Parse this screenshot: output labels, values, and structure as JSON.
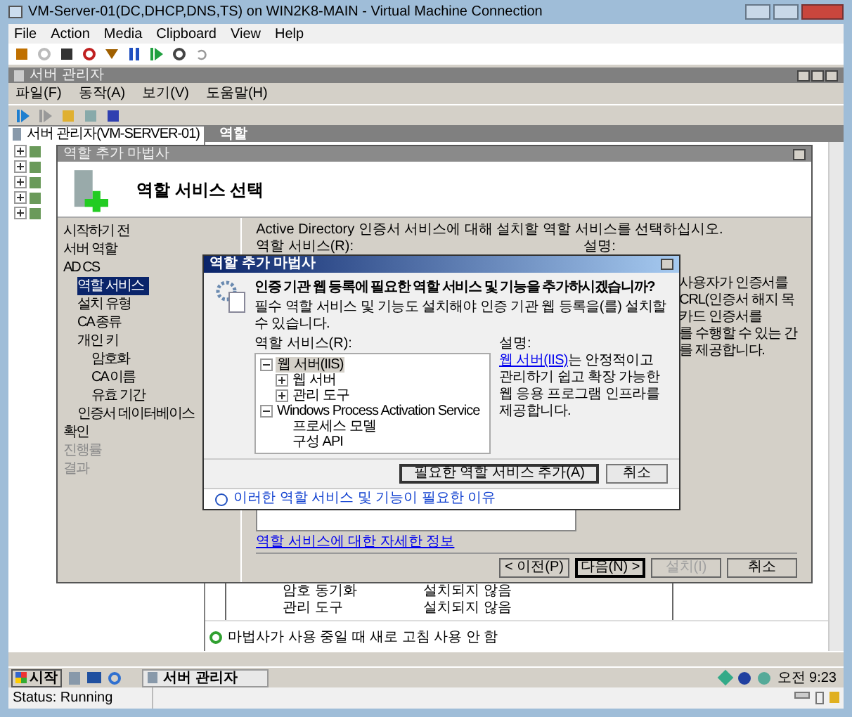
{
  "vm_window": {
    "title": "VM-Server-01(DC,DHCP,DNS,TS) on WIN2K8-MAIN - Virtual Machine Connection",
    "menu": [
      "File",
      "Action",
      "Media",
      "Clipboard",
      "View",
      "Help"
    ],
    "status": "Status: Running"
  },
  "server_manager": {
    "title": "서버 관리자",
    "menu": [
      "파일(F)",
      "동작(A)",
      "보기(V)",
      "도움말(H)"
    ],
    "tree_root": "서버 관리자(VM-SERVER-01)",
    "pane_title": "역할",
    "rows": [
      {
        "name": "암호 동기화",
        "status": "설치되지 않음"
      },
      {
        "name": "관리 도구",
        "status": "설치되지 않음"
      }
    ],
    "refresh_note": "마법사가 사용 중일 때 새로 고침 사용 안 함"
  },
  "wizard": {
    "title": "역할 추가 마법사",
    "heading": "역할 서비스 선택",
    "nav": [
      {
        "label": "시작하기 전",
        "selected": false,
        "disabled": false
      },
      {
        "label": "서버 역할",
        "selected": false,
        "disabled": false
      },
      {
        "label": "AD CS",
        "selected": false,
        "disabled": false,
        "children": [
          {
            "label": "역할 서비스",
            "selected": true,
            "disabled": false
          },
          {
            "label": "설치 유형",
            "selected": false,
            "disabled": false
          },
          {
            "label": "CA 종류",
            "selected": false,
            "disabled": false
          },
          {
            "label": "개인 키",
            "selected": false,
            "disabled": false,
            "children": [
              {
                "label": "암호화",
                "selected": false,
                "disabled": false
              },
              {
                "label": "CA 이름",
                "selected": false,
                "disabled": false
              },
              {
                "label": "유효 기간",
                "selected": false,
                "disabled": false
              }
            ]
          },
          {
            "label": "인증서 데이터베이스",
            "selected": false,
            "disabled": false
          }
        ]
      },
      {
        "label": "확인",
        "selected": false,
        "disabled": false
      },
      {
        "label": "진행률",
        "selected": false,
        "disabled": true
      },
      {
        "label": "결과",
        "selected": false,
        "disabled": true
      }
    ],
    "intro": "Active Directory 인증서 서비스에 대해 설치할 역할 서비스를 선택하십시오.",
    "list_label": "역할 서비스(R):",
    "description_label": "설명:",
    "description_fragments": [
      "사용자가 인증서를",
      "CRL(인증서 해지 목",
      "카드 인증서를",
      "를 수행할 수 있는 간",
      "를 제공합니다."
    ],
    "more_info_link": "역할 서비스에 대한 자세한 정보",
    "buttons": [
      {
        "label": "< 이전(P)",
        "disabled": false,
        "default": false
      },
      {
        "label": "다음(N) >",
        "disabled": false,
        "default": true
      },
      {
        "label": "설치(I)",
        "disabled": true,
        "default": false
      },
      {
        "label": "취소",
        "disabled": false,
        "default": false
      }
    ]
  },
  "dialog": {
    "title": "역할 추가 마법사",
    "question": "인증 기관 웹 등록에 필요한 역할 서비스 및 기능을 추가하시겠습니까?",
    "subtitle": "필수 역할 서비스 및 기능도 설치해야 인증 기관 웹 등록을(를) 설치할 수 있습니다.",
    "list_label": "역할 서비스(R):",
    "tree": [
      {
        "label": "웹 서버(IIS)",
        "expanded": true,
        "selected": true,
        "children": [
          {
            "label": "웹 서버",
            "expanded": false,
            "selected": false
          },
          {
            "label": "관리 도구",
            "expanded": false,
            "selected": false
          }
        ]
      },
      {
        "label": "Windows Process Activation Service",
        "expanded": true,
        "selected": false,
        "children": [
          {
            "label": "프로세스 모델",
            "selected": false
          },
          {
            "label": "구성 API",
            "selected": false
          }
        ]
      }
    ],
    "description_label": "설명:",
    "description_link": "웹 서버(IIS)",
    "description_text": "는 안정적이고 관리하기 쉽고 확장 가능한 웹 응용 프로그램 인프라를 제공합니다.",
    "buttons": [
      "필요한 역할 서비스 추가(A)",
      "취소"
    ],
    "help_link": "이러한 역할 서비스 및 기능이 필요한 이유"
  },
  "taskbar": {
    "start": "시작",
    "task": "서버 관리자",
    "clock": "오전 9:23"
  }
}
